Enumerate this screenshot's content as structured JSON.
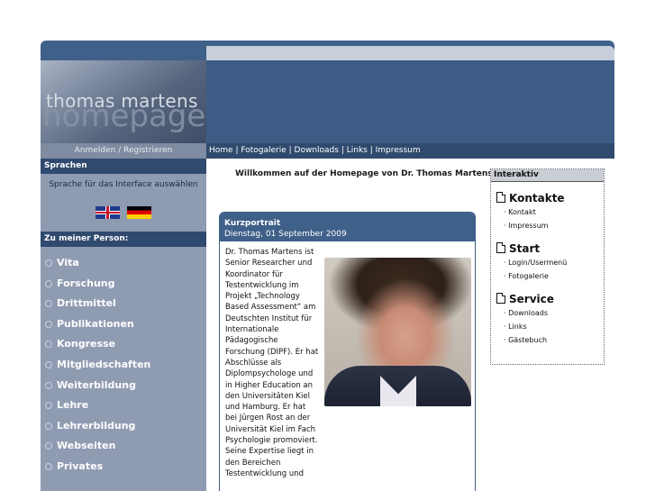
{
  "header": {
    "logo_line1": "thomas martens",
    "logo_line2": "homepage"
  },
  "nav": {
    "login_label": "Anmelden / Registrieren",
    "items": [
      "Home",
      "Fotogalerie",
      "Downloads",
      "Links",
      "Impressum"
    ],
    "separator": " | "
  },
  "sidebar": {
    "languages_title": "Sprachen",
    "languages_text": "Sprache für das Interface auswählen",
    "flags": [
      "english-flag-icon",
      "german-flag-icon"
    ],
    "person_title": "Zu meiner Person:",
    "menu": [
      "Vita",
      "Forschung",
      "Drittmittel",
      "Publikationen",
      "Kongresse",
      "Mitgliedschaften",
      "Weiterbildung",
      "Lehre",
      "Lehrerbildung",
      "Webseiten",
      "Privates"
    ]
  },
  "main": {
    "welcome": "Willkommen auf der Homepage von Dr. Thomas Martens",
    "portrait": {
      "title": "Kurzportrait",
      "date": "Dienstag, 01 September 2009",
      "bio": "Dr. Thomas Martens ist Senior Researcher und Koordinator für Testentwicklung im Projekt „Technology Based Assessment“ am Deutschten Institut für Internationale Pädagogische Forschung (DIPF). Er hat Abschlüsse als Diplompsychologe und in Higher Education an den Universitäten Kiel und Hamburg. Er hat bei Jürgen Rost an der Universität Kiel im Fach Psychologie promoviert. Seine Expertise liegt in den Bereichen Testentwicklung und"
    }
  },
  "interaktiv": {
    "title": "Interaktiv",
    "sections": [
      {
        "title": "Kontakte",
        "items": [
          "Kontakt",
          "Impressum"
        ]
      },
      {
        "title": "Start",
        "items": [
          "Login/Usermenü",
          "Fotogalerie"
        ]
      },
      {
        "title": "Service",
        "items": [
          "Downloads",
          "Links",
          "Gästebuch"
        ]
      }
    ]
  },
  "colors": {
    "header_blue": "#3f6089",
    "sidebar_gray": "#8f9bb1",
    "nav_dark": "#2f4a6e"
  }
}
